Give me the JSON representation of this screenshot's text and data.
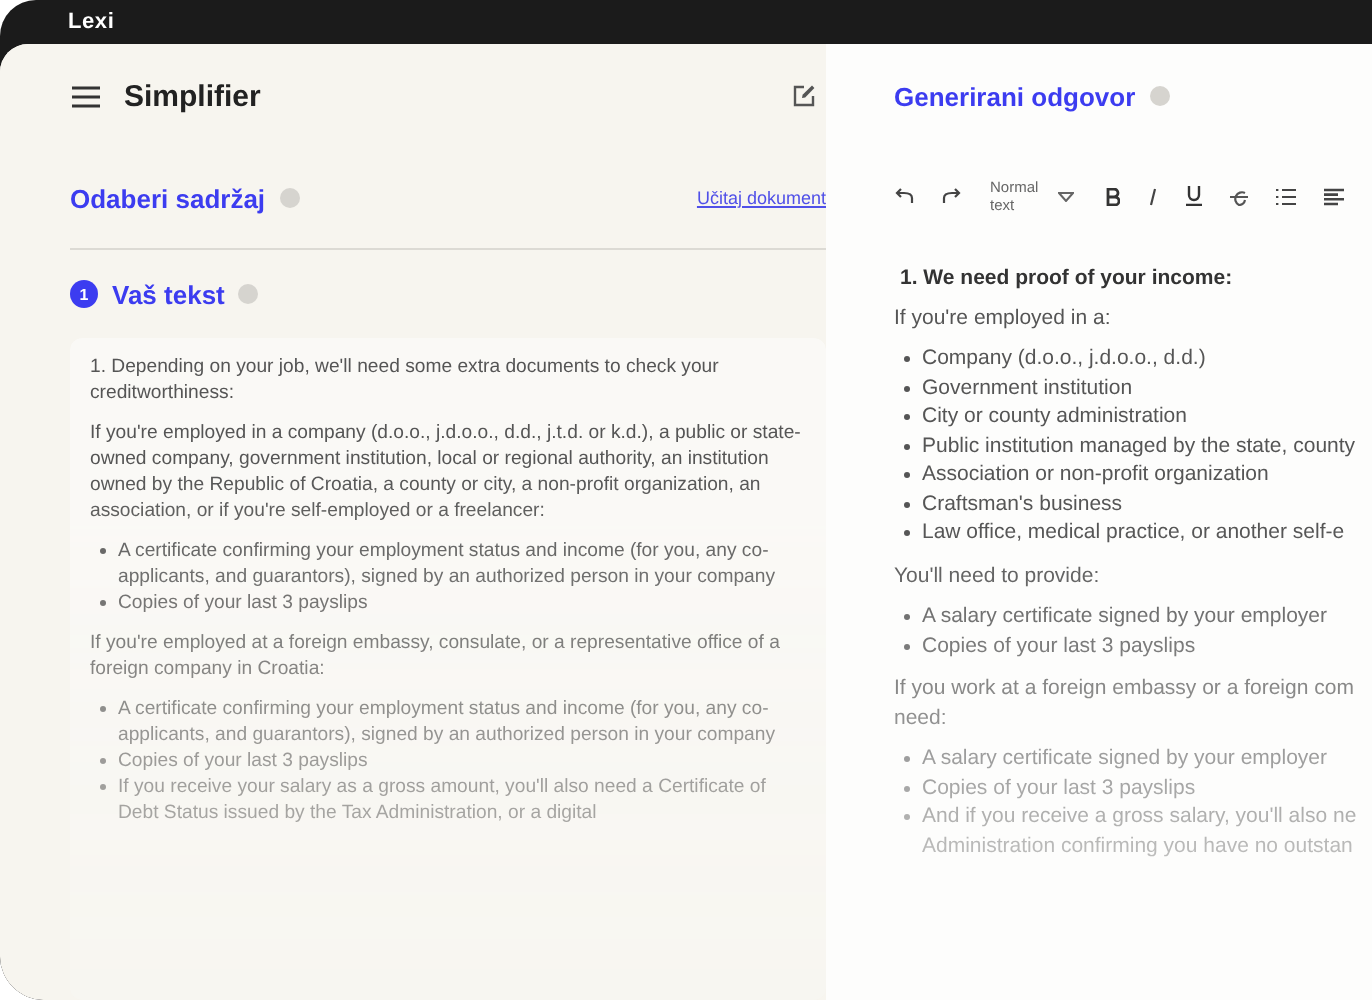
{
  "app": {
    "logo": "Lexi"
  },
  "left": {
    "title": "Simplifier",
    "section": {
      "title": "Odaberi sadržaj",
      "link": "Učitaj dokument"
    },
    "step": {
      "number": "1",
      "title": "Vaš tekst"
    },
    "blocks": [
      {
        "kind": "para",
        "text": "1. Depending on your job, we'll need some extra documents to check your creditworthiness:"
      },
      {
        "kind": "para",
        "text": "If you're employed in a company (d.o.o., j.d.o.o., d.d., j.t.d. or k.d.), a public or state-owned company, government institution, local or regional authority, an institution owned by the Republic of Croatia, a county or city, a non-profit organization, an association, or if you're self-employed or a freelancer:"
      },
      {
        "kind": "list",
        "items": [
          "A certificate confirming your employment status and income (for you, any co-applicants, and guarantors), signed by an authorized person in your company",
          "Copies of your last 3 payslips"
        ]
      },
      {
        "kind": "para",
        "text": "If you're employed at a foreign embassy, consulate, or a representative office of a foreign company in Croatia:"
      },
      {
        "kind": "list",
        "items": [
          "A certificate confirming your employment status and income (for you, any co-applicants, and guarantors), signed by an authorized person in your company",
          "Copies of your last 3 payslips",
          "If you receive your salary as a gross amount, you'll also need a Certificate of Debt Status issued by the Tax Administration, or a digital"
        ]
      }
    ]
  },
  "right": {
    "title": "Generirani odgovor",
    "toolbar": {
      "style": "Normal text"
    },
    "blocks": [
      {
        "kind": "heading",
        "lines": [
          "1. We need proof of your income:"
        ]
      },
      {
        "kind": "para",
        "lines": [
          "If you're employed in a:"
        ]
      },
      {
        "kind": "list",
        "items": [
          [
            "Company (d.o.o., j.d.o.o., d.d.)"
          ],
          [
            "Government institution"
          ],
          [
            "City or county administration"
          ],
          [
            "Public institution managed by the state, county"
          ],
          [
            "Association or non-profit organization"
          ],
          [
            "Craftsman's business"
          ],
          [
            "Law office, medical practice, or another self-e"
          ]
        ]
      },
      {
        "kind": "para",
        "lines": [
          "You'll need to provide:"
        ]
      },
      {
        "kind": "list",
        "items": [
          [
            "A salary certificate signed by your employer"
          ],
          [
            "Copies of your last 3 payslips"
          ]
        ]
      },
      {
        "kind": "para",
        "lines": [
          "If you work at a foreign embassy or a foreign com",
          "need:"
        ]
      },
      {
        "kind": "list",
        "items": [
          [
            "A salary certificate signed by your employer"
          ],
          [
            "Copies of your last 3 payslips"
          ],
          [
            "And if you receive a gross salary, you'll also ne",
            "Administration confirming you have no outstan"
          ]
        ]
      }
    ]
  }
}
